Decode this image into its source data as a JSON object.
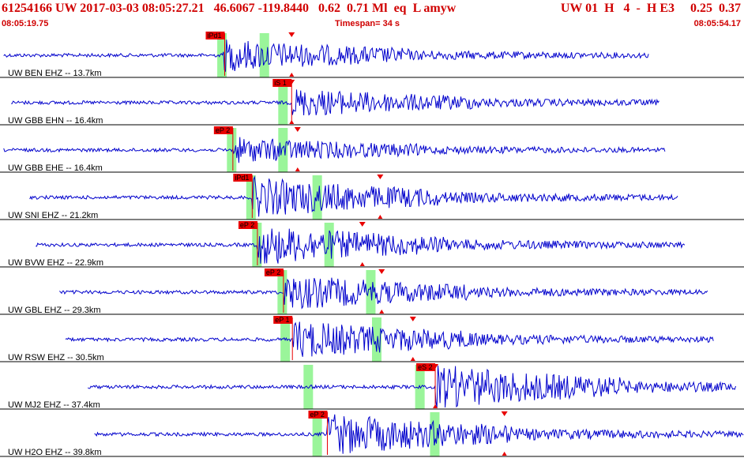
{
  "header": {
    "event_line": "61254166 UW 2017-03-03 08:05:27.21   46.6067 -119.8440   0.62  0.71 Ml  eq  L amyw",
    "event_right": "UW 01  H   4  -  H E3     0.25  0.37",
    "start_time": "08:05:19.75",
    "timespan": "Timespan=  34 s",
    "end_time": "08:05:54.17"
  },
  "colors": {
    "header_text": "#d00000",
    "trace": "#0000cc",
    "window": "#9af59a",
    "pick_box": "#e80000",
    "pick_line": "#e80000"
  },
  "traces": [
    {
      "label": "UW BEN EHZ -- 13.7km",
      "start": 0.005,
      "end": 0.872,
      "pick_label": "iPd1",
      "pick": 0.302,
      "s_pick": 0.392,
      "windows": [
        0.292,
        0.349
      ],
      "onset": 0.3,
      "burst": 0.37,
      "amp": 0.32
    },
    {
      "label": "UW GBB EHN -- 16.4km",
      "start": 0.015,
      "end": 0.886,
      "pick_label": "iS 1",
      "pick": 0.392,
      "s_pick": 0.392,
      "windows": [
        0.374
      ],
      "onset": 0.393,
      "burst": 0.4,
      "amp": 0.28
    },
    {
      "label": "UW GBB EHE -- 16.4km",
      "start": 0.005,
      "end": 0.894,
      "pick_label": "eP 2",
      "pick": 0.313,
      "s_pick": 0.4,
      "windows": [
        0.305,
        0.374
      ],
      "onset": 0.313,
      "burst": 0.4,
      "amp": 0.25
    },
    {
      "label": "UW SNI EHZ -- 21.2km",
      "start": 0.04,
      "end": 0.912,
      "pick_label": "iPd1",
      "pick": 0.339,
      "s_pick": 0.511,
      "windows": [
        0.331,
        0.42
      ],
      "onset": 0.339,
      "burst": 0.51,
      "amp": 0.4
    },
    {
      "label": "UW BVW EHZ -- 22.9km",
      "start": 0.048,
      "end": 0.921,
      "pick_label": "eP 2",
      "pick": 0.346,
      "s_pick": 0.487,
      "windows": [
        0.339,
        0.436
      ],
      "onset": 0.346,
      "burst": 0.5,
      "amp": 0.4
    },
    {
      "label": "UW GBL EHZ -- 29.3km",
      "start": 0.08,
      "end": 0.952,
      "pick_label": "eP 2",
      "pick": 0.381,
      "s_pick": 0.513,
      "windows": [
        0.373,
        0.492
      ],
      "onset": 0.381,
      "burst": 0.54,
      "amp": 0.35
    },
    {
      "label": "UW RSW EHZ -- 30.5km",
      "start": 0.088,
      "end": 0.96,
      "pick_label": "eP 1",
      "pick": 0.393,
      "s_pick": 0.555,
      "windows": [
        0.377,
        0.5
      ],
      "onset": 0.393,
      "burst": 0.56,
      "amp": 0.38
    },
    {
      "label": "UW MJ2 EHZ -- 37.4km",
      "start": 0.118,
      "end": 0.99,
      "pick_label": "eS 2",
      "pick": 0.585,
      "s_pick": 0.585,
      "windows": [
        0.408,
        0.558
      ],
      "onset": 0.585,
      "burst": 0.6,
      "amp": 0.45
    },
    {
      "label": "UW H2O EHZ -- 39.8km",
      "start": 0.127,
      "end": 1.0,
      "pick_label": "eP 2",
      "pick": 0.44,
      "s_pick": 0.678,
      "windows": [
        0.42,
        0.578
      ],
      "onset": 0.44,
      "burst": 0.66,
      "amp": 0.42
    }
  ]
}
